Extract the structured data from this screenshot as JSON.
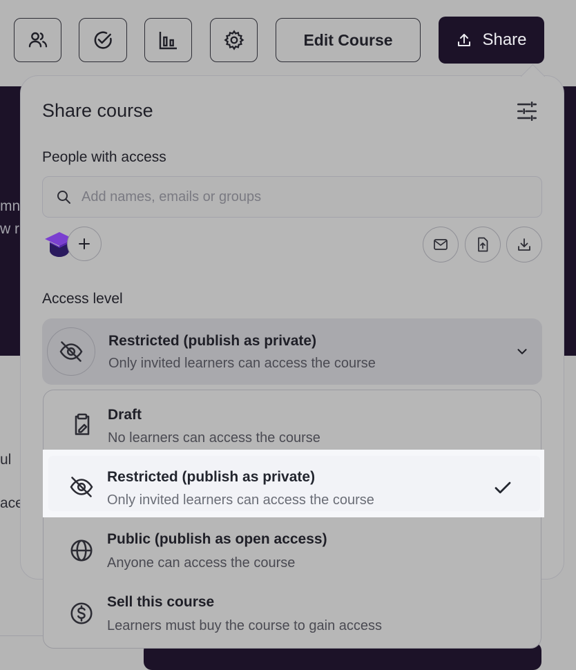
{
  "toolbar": {
    "edit_course_label": "Edit Course",
    "share_label": "Share",
    "icons": [
      "users-icon",
      "check-circle-icon",
      "bar-chart-icon",
      "gear-icon"
    ]
  },
  "background": {
    "fragments": [
      "mn",
      "w r",
      "ul",
      "ace"
    ]
  },
  "share_panel": {
    "title": "Share course",
    "people_section_label": "People with access",
    "search_placeholder": "Add names, emails or groups",
    "access_section_label": "Access level",
    "selected_access": {
      "title": "Restricted (publish as private)",
      "description": "Only invited learners can access the course"
    }
  },
  "access_options": [
    {
      "title": "Draft",
      "description": "No learners can access the course",
      "icon": "clipboard-icon",
      "selected": false
    },
    {
      "title": "Restricted (publish as private)",
      "description": "Only invited learners can access the course",
      "icon": "eye-off-icon",
      "selected": true
    },
    {
      "title": "Public (publish as open access)",
      "description": "Anyone can access the course",
      "icon": "globe-icon",
      "selected": false
    },
    {
      "title": "Sell this course",
      "description": "Learners must buy the course to gain access",
      "icon": "dollar-circle-icon",
      "selected": false
    }
  ],
  "colors": {
    "brand_dark": "#1c1228",
    "overlay_gray": "#b5b5b5",
    "highlight": "#f6f7fa"
  }
}
